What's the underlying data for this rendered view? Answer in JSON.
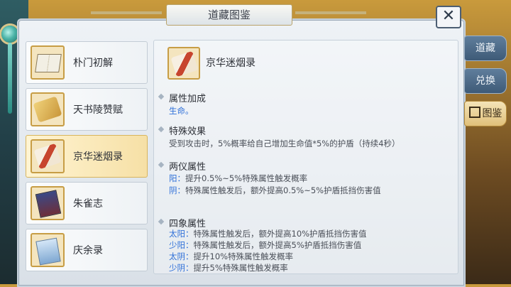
{
  "window": {
    "title": "道藏图鉴",
    "close_glyph": "✕"
  },
  "tabs": [
    {
      "label": "道藏",
      "active": false
    },
    {
      "label": "兑换",
      "active": false
    },
    {
      "label": "图鉴",
      "active": true
    }
  ],
  "list": [
    {
      "name": "朴门初解",
      "icon": "book-icon",
      "selected": false
    },
    {
      "name": "天书陵赞赋",
      "icon": "scroll-icon",
      "selected": false
    },
    {
      "name": "京华迷烟录",
      "icon": "red-scroll-icon",
      "selected": true
    },
    {
      "name": "朱雀志",
      "icon": "tome-icon",
      "selected": false
    },
    {
      "name": "庆余录",
      "icon": "blue-book-icon",
      "selected": false
    }
  ],
  "detail": {
    "name": "京华迷烟录",
    "attr_bonus": {
      "heading": "属性加成",
      "value": "生命。"
    },
    "special": {
      "heading": "特殊效果",
      "text": "受到攻击时，5%概率给自己增加生命值*5%的护盾（持续4秒）"
    },
    "liangyi": {
      "heading": "两仪属性",
      "lines": [
        {
          "key": "阳：",
          "text": "提升0.5%~5%特殊属性触发概率"
        },
        {
          "key": "阴：",
          "text": "特殊属性触发后，额外提高0.5%~5%护盾抵挡伤害值"
        }
      ]
    },
    "sixiang": {
      "heading": "四象属性",
      "lines": [
        {
          "key": "太阳：",
          "text": "特殊属性触发后，额外提高10%护盾抵挡伤害值"
        },
        {
          "key": "少阳：",
          "text": "特殊属性触发后，额外提高5%护盾抵挡伤害值"
        },
        {
          "key": "太阴：",
          "text": "提升10%特殊属性触发概率"
        },
        {
          "key": "少阴：",
          "text": "提升5%特殊属性触发概率"
        }
      ]
    }
  },
  "colors": {
    "accent_blue": "#2e6fd8",
    "selected_gold": "#f6e0a6"
  }
}
